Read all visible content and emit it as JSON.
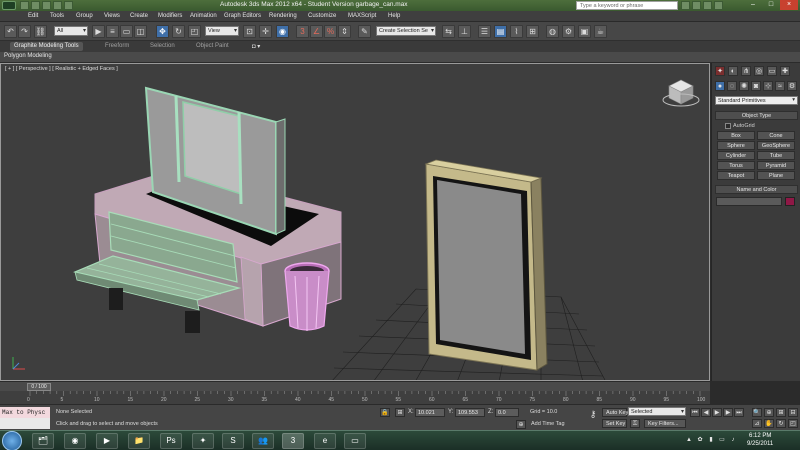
{
  "window": {
    "title": "Autodesk 3ds Max  2012 x64   - Student Version   garbage_can.max",
    "search_placeholder": "Type a keyword or phrase"
  },
  "menu": [
    "Edit",
    "Tools",
    "Group",
    "Views",
    "Create",
    "Modifiers",
    "Animation",
    "Graph Editors",
    "Rendering",
    "Customize",
    "MAXScript",
    "Help"
  ],
  "toolbar": {
    "selection_filter": "All",
    "ref_coord": "View",
    "named_selection": "Create Selection Se"
  },
  "ribbon": {
    "tabs": [
      "Graphite Modeling Tools",
      "Freeform",
      "Selection",
      "Object Paint"
    ],
    "subtab": "Polygon Modeling"
  },
  "viewport": {
    "label": "[ + ] [ Perspective ] [ Realistic + Edged Faces ]"
  },
  "command_panel": {
    "category": "Standard Primitives",
    "object_type_title": "Object Type",
    "autogrid": "AutoGrid",
    "buttons": [
      "Box",
      "Cone",
      "Sphere",
      "GeoSphere",
      "Cylinder",
      "Tube",
      "Torus",
      "Pyramid",
      "Teapot",
      "Plane"
    ],
    "name_color_title": "Name and Color",
    "object_color": "#8f1846"
  },
  "timeline": {
    "frame": "0 / 100",
    "ticks": [
      "0",
      "5",
      "10",
      "15",
      "20",
      "25",
      "30",
      "35",
      "40",
      "45",
      "50",
      "55",
      "60",
      "65",
      "70",
      "75",
      "80",
      "85",
      "90",
      "95",
      "100"
    ]
  },
  "status": {
    "maxscript": "Max to Physc",
    "selection": "None Selected",
    "prompt": "Click and drag to select and move objects",
    "x_label": "X:",
    "x_value": "10.021",
    "y_label": "Y:",
    "y_value": "109.553",
    "z_label": "Z:",
    "z_value": "0.0",
    "grid": "Grid = 10.0",
    "add_time_tag": "Add Time Tag",
    "auto_key": "Auto Key",
    "selected": "Selected",
    "set_key": "Set Key",
    "key_filters": "Key Filters..."
  },
  "taskbar": {
    "time": "6:12 PM",
    "date": "9/25/2011"
  }
}
